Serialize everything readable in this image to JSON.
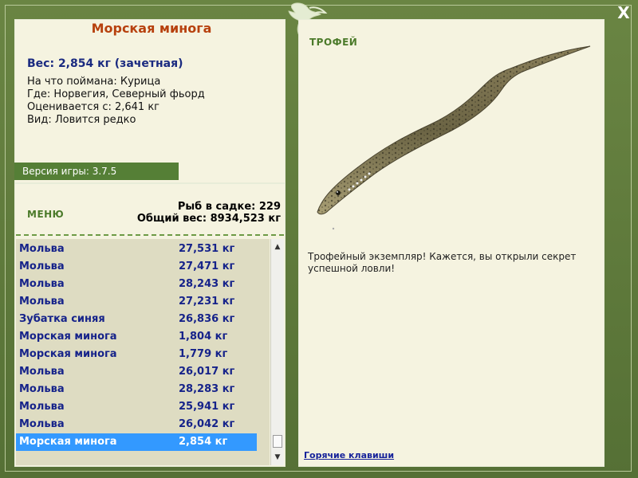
{
  "header": {
    "close_label": "X"
  },
  "fish": {
    "title": "Морская минога",
    "weight": "Вес: 2,854 кг (зачетная)",
    "details": [
      "На что поймана: Курица",
      "Где: Норвегия, Северный фьорд",
      "Оценивается с: 2,641 кг",
      "Вид: Ловится редко"
    ]
  },
  "version": "Версия игры: 3.7.5",
  "menu": {
    "label": "МЕНЮ",
    "stats": [
      "Рыб в садке: 229",
      "Общий вес: 8934,523 кг"
    ]
  },
  "catch_list": [
    {
      "name": "Мольва",
      "weight": "27,531 кг"
    },
    {
      "name": "Мольва",
      "weight": "27,471 кг"
    },
    {
      "name": "Мольва",
      "weight": "28,243 кг"
    },
    {
      "name": "Мольва",
      "weight": "27,231 кг"
    },
    {
      "name": "Зубатка синяя",
      "weight": "26,836 кг"
    },
    {
      "name": "Морская минога",
      "weight": "1,804 кг"
    },
    {
      "name": "Морская минога",
      "weight": "1,779 кг"
    },
    {
      "name": "Мольва",
      "weight": "26,017 кг"
    },
    {
      "name": "Мольва",
      "weight": "28,283 кг"
    },
    {
      "name": "Мольва",
      "weight": "25,941 кг"
    },
    {
      "name": "Мольва",
      "weight": "26,042 кг"
    },
    {
      "name": "Морская минога",
      "weight": "2,854 кг"
    }
  ],
  "selected_index": 11,
  "trophy": {
    "label": "ТРОФЕЙ",
    "text": "Трофейный экземпляр! Кажется, вы открыли секрет успешной ловли!"
  },
  "hotkeys_label": "Горячие клавиши",
  "colors": {
    "frame": "#5e7a3a",
    "panel": "#f5f3e0",
    "title": "#b7410e",
    "list_text": "#16238a",
    "selected": "#3399ff"
  }
}
